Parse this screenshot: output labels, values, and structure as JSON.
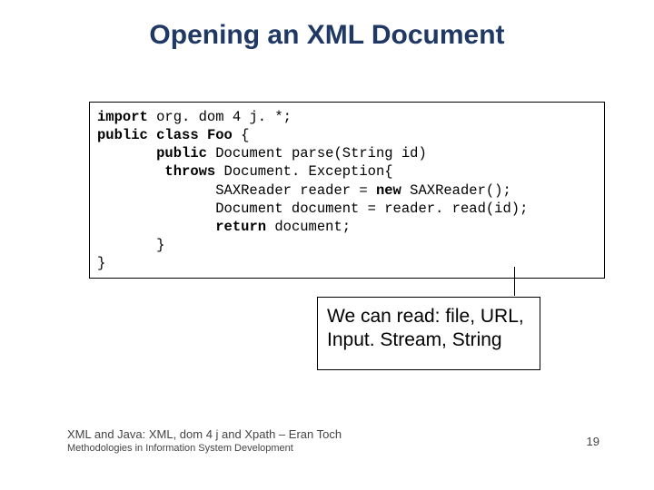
{
  "title": "Opening an XML Document",
  "code": {
    "l1a": "import",
    "l1b": " org. dom 4 j. *;",
    "l2a": "public",
    "l2b": "class",
    "l2c": "Foo",
    "l2d": " {",
    "l3a": "       ",
    "l3b": "public",
    "l3c": " Document parse(String id)",
    "l4a": "        ",
    "l4b": "throws",
    "l4c": " Document. Exception{",
    "l5a": "              SAXReader reader = ",
    "l5b": "new",
    "l5c": " SAXReader();",
    "l6": "              Document document = reader. read(id);",
    "l7a": "              ",
    "l7b": "return",
    "l7c": " document;",
    "l8": "       }",
    "l9": "}"
  },
  "callout": "We can read: file, URL, Input. Stream, String",
  "footer": {
    "main": "XML and Java: XML, dom 4 j and Xpath – Eran Toch",
    "sub": "Methodologies in Information System Development"
  },
  "page": "19"
}
